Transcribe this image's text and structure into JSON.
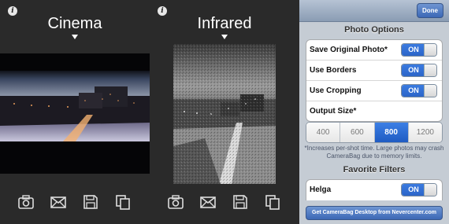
{
  "screens": [
    {
      "filter_name": "Cinema",
      "info_icon": "i",
      "effect": "cinema"
    },
    {
      "filter_name": "Infrared",
      "info_icon": "i",
      "effect": "infrared"
    }
  ],
  "toolbar_icons": [
    "camera-icon",
    "mail-icon",
    "save-icon",
    "copy-icon"
  ],
  "settings": {
    "done_label": "Done",
    "photo_options_title": "Photo Options",
    "options": [
      {
        "label": "Save Original Photo*",
        "toggle": "ON"
      },
      {
        "label": "Use Borders",
        "toggle": "ON"
      },
      {
        "label": "Use Cropping",
        "toggle": "ON"
      },
      {
        "label": "Output Size*"
      }
    ],
    "output_sizes": [
      "400",
      "600",
      "800",
      "1200"
    ],
    "selected_size": "800",
    "note": "*Increases per-shot time. Large photos may crash CameraBag due to memory limits.",
    "favorite_filters_title": "Favorite Filters",
    "favorites": [
      {
        "label": "Helga",
        "toggle": "ON"
      }
    ],
    "footer_label": "Get CameraBag Desktop from Nevercenter.com"
  },
  "colors": {
    "accent": "#2c65c8",
    "panel_bg": "#c5ccd4",
    "dark_bg": "#2a2a2a"
  }
}
